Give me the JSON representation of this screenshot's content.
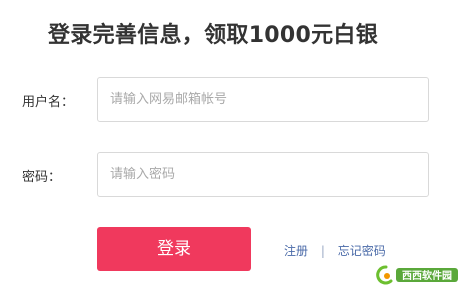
{
  "header": {
    "title": "登录完善信息，领取1000元白银"
  },
  "form": {
    "username_label": "用户名：",
    "username_placeholder": "请输入网易邮箱帐号",
    "password_label": "密码：",
    "password_placeholder": "请输入密码",
    "login_button": "登录"
  },
  "links": {
    "register": "注册",
    "separator": "|",
    "forgot_password": "忘记密码"
  },
  "colors": {
    "accent_button": "#f0395d",
    "link": "#4a6aa8"
  },
  "watermark": {
    "icon": "site-logo-icon",
    "text": "西西软件园"
  }
}
